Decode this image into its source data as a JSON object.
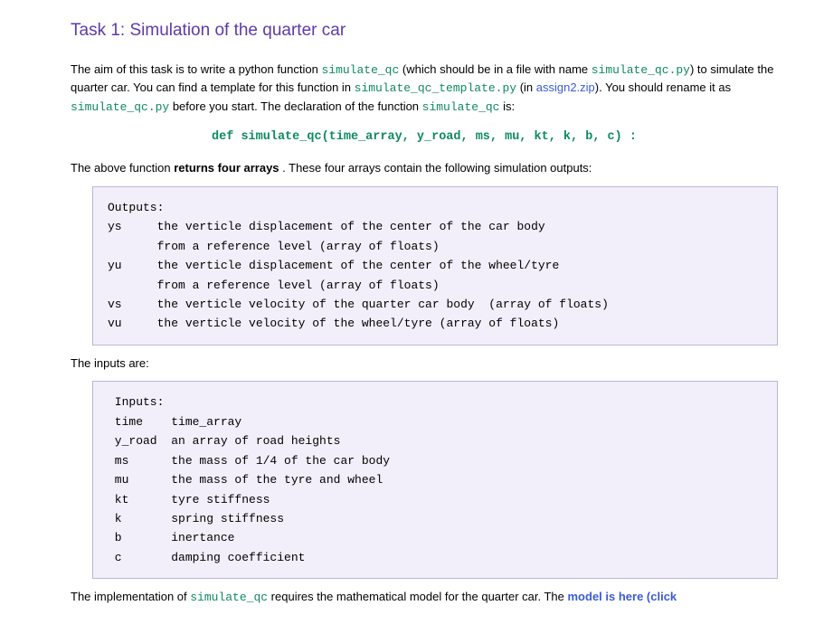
{
  "heading": "Task 1: Simulation of the quarter car",
  "para1": {
    "t1": "The aim of this task is to write a python function ",
    "c1": "simulate_qc",
    "t2": " (which should be in a file with name ",
    "c2": "simulate_qc.py",
    "t3": ") to simulate the quarter car. You can find a template for this function in ",
    "c3": "simulate_qc_template.py",
    "t4": "  (in ",
    "l1": "assign2.zip",
    "t5": "). You should rename it as ",
    "c4": "simulate_qc.py",
    "t6": " before you start. The declaration of the function ",
    "c5": "simulate_qc",
    "t7": "  is:"
  },
  "def_signature": "def simulate_qc(time_array, y_road, ms, mu, kt, k, b, c) :",
  "para2": {
    "t1": "The above function ",
    "b1": "returns four arrays",
    "t2": " . These four arrays contain the following simulation outputs:"
  },
  "outputs_block": "Outputs:\nys     the verticle displacement of the center of the car body\n       from a reference level (array of floats)\nyu     the verticle displacement of the center of the wheel/tyre\n       from a reference level (array of floats)\nvs     the verticle velocity of the quarter car body  (array of floats)\nvu     the verticle velocity of the wheel/tyre (array of floats)",
  "inputs_label": "The inputs are:",
  "inputs_block": " Inputs:\n time    time_array\n y_road  an array of road heights\n ms      the mass of 1/4 of the car body\n mu      the mass of the tyre and wheel\n kt      tyre stiffness\n k       spring stiffness\n b       inertance\n c       damping coefficient",
  "para3": {
    "t1": "The implementation of ",
    "c1": "simulate_qc",
    "t2": " requires the mathematical model for the quarter car. The ",
    "l1": "model is here (click"
  }
}
